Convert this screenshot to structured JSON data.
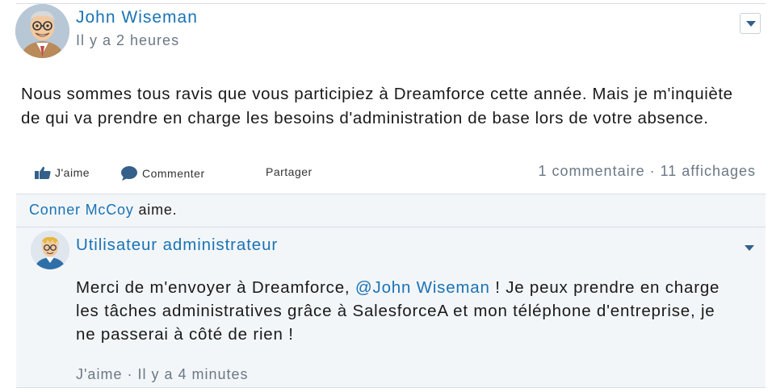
{
  "post": {
    "author": "John Wiseman",
    "timestamp": "Il y a 2 heures",
    "body": "Nous sommes tous ravis que vous participiez à Dreamforce cette année. Mais je m'inquiète de qui va prendre en charge les besoins d'administration de base lors de votre absence.",
    "actions": {
      "like_label": "J'aime",
      "comment_label": "Commenter",
      "share_label": "Partager"
    },
    "stats": "1 commentaire · 11 affichages",
    "menu_icon": "chevron-down-icon"
  },
  "likes": {
    "name": "Conner McCoy",
    "suffix": " aime."
  },
  "comment": {
    "author": "Utilisateur administrateur",
    "text_before": "Merci de m'envoyer à Dreamforce, ",
    "mention": "@John Wiseman",
    "text_after": " ! Je peux prendre en charge les tâches administratives grâce à SalesforceA et mon téléphone d'entreprise, je ne passerai à côté de rien !",
    "meta": "J'aime · Il y a 4 minutes"
  },
  "colors": {
    "link": "#1a73b5",
    "muted": "#6b7885",
    "panel": "#f3f6f9",
    "divider": "#d8dde6"
  }
}
